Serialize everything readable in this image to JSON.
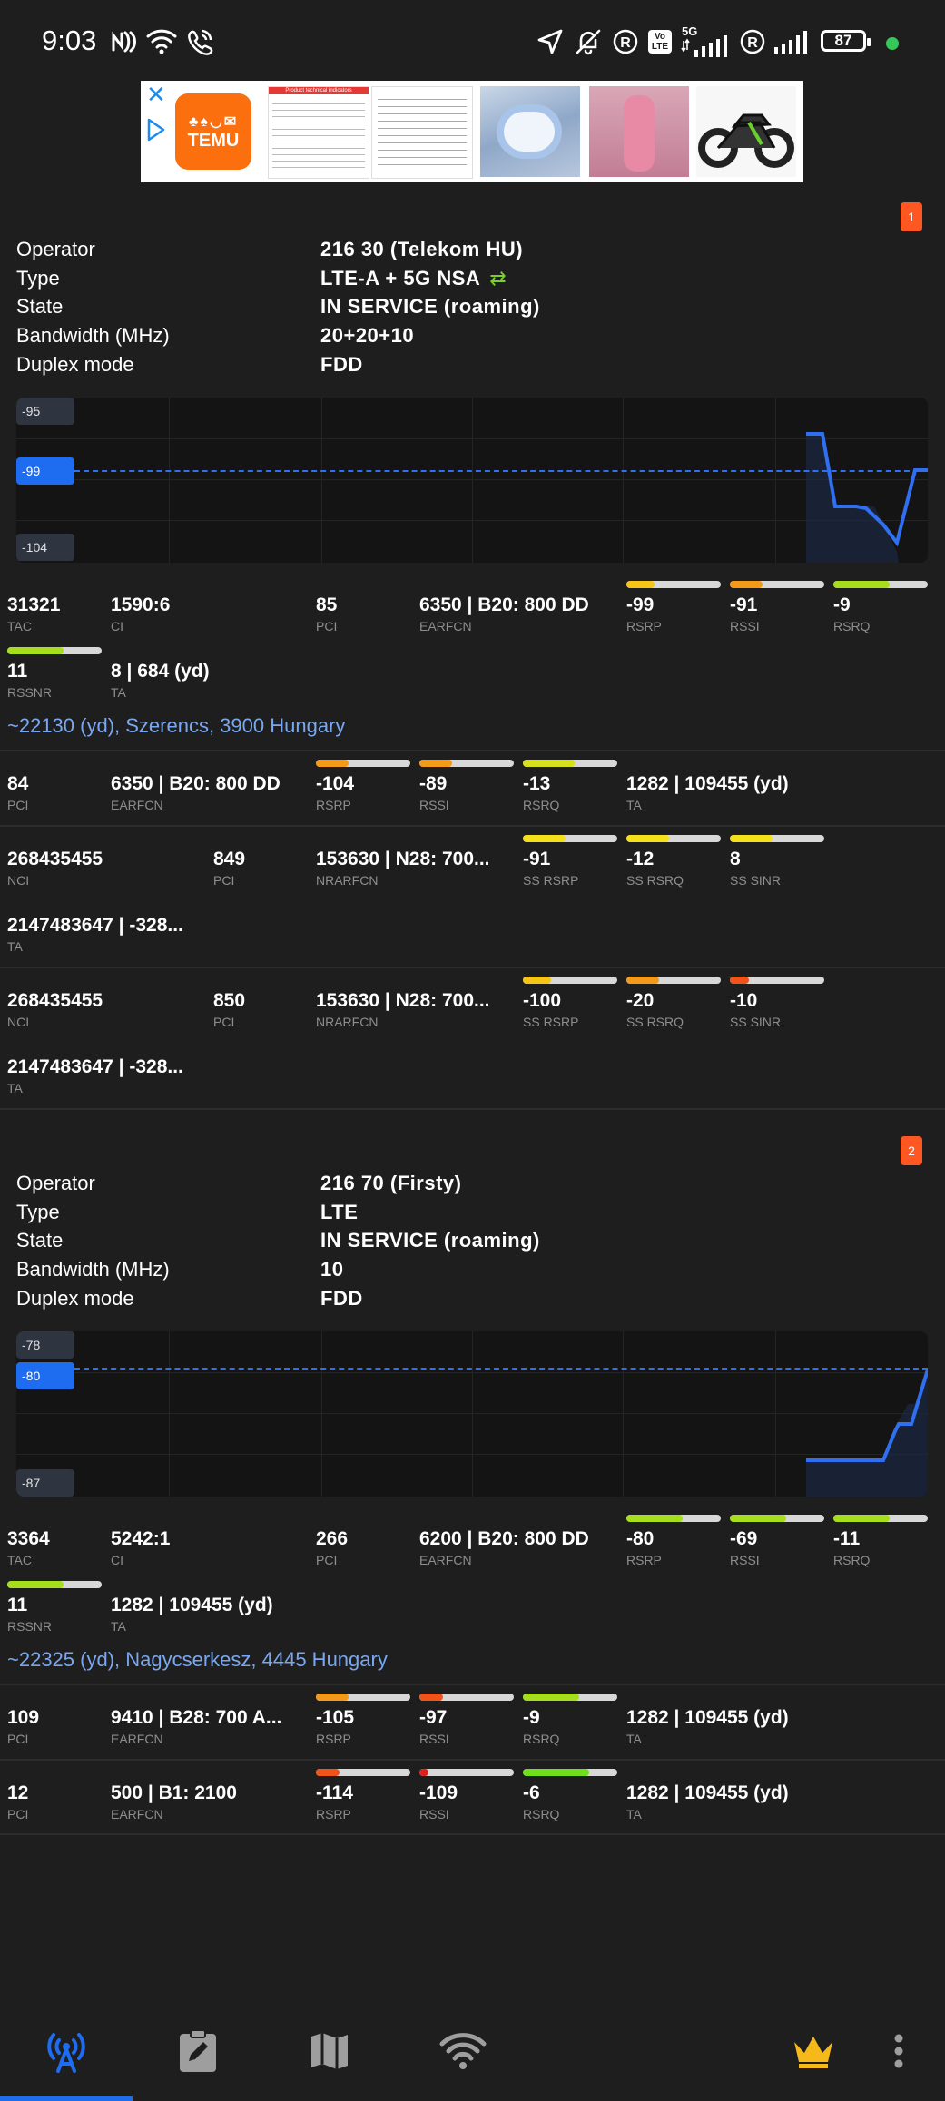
{
  "status_bar": {
    "time": "9:03",
    "battery": "87",
    "icons": [
      "nfc-icon",
      "wifi-icon",
      "wifi-calling-icon",
      "location-arrow-icon",
      "bell-off-icon",
      "roaming-icon",
      "volte-icon",
      "signal-5g-icon",
      "roaming-icon-2",
      "signal-icon"
    ],
    "network_label": "5G",
    "volte_label": "Vo LTE",
    "roaming_letter": "R"
  },
  "ad": {
    "brand": "TEMU",
    "sheet_header": "Product technical indicators"
  },
  "sims": [
    {
      "badge": "1",
      "info": [
        {
          "label": "Operator",
          "value": "216 30 (Telekom HU)"
        },
        {
          "label": "Type",
          "value": "LTE-A + 5G NSA"
        },
        {
          "label": "State",
          "value": "IN SERVICE (roaming)"
        },
        {
          "label": "Bandwidth (MHz)",
          "value": "20+20+10"
        },
        {
          "label": "Duplex mode",
          "value": "FDD"
        }
      ],
      "graph": {
        "top": "-95",
        "current": "-99",
        "bottom": "-104"
      },
      "primary": {
        "row1": [
          {
            "value": "31321",
            "label": "TAC"
          },
          {
            "value": "1590:6",
            "label": "CI"
          },
          {
            "value": "85",
            "label": "PCI"
          },
          {
            "value": "6350 | B20: 800 DD",
            "label": "EARFCN"
          },
          {
            "value": "-99",
            "label": "RSRP",
            "level": 0.3,
            "color": "#f5c518"
          },
          {
            "value": "-91",
            "label": "RSSI",
            "level": 0.35,
            "color": "#f39a1a"
          },
          {
            "value": "-9",
            "label": "RSRQ",
            "level": 0.6,
            "color": "#a6dd1c"
          }
        ],
        "row2": [
          {
            "value": "11",
            "label": "RSSNR",
            "level": 0.6,
            "color": "#a6dd1c"
          },
          {
            "value": "8 | 684 (yd)",
            "label": "TA"
          }
        ],
        "location": "~22130 (yd), Szerencs, 3900 Hungary"
      },
      "neighbors_lte": [
        {
          "cells": [
            {
              "value": "84",
              "label": "PCI"
            },
            {
              "value": "6350 | B20: 800 DD",
              "label": "EARFCN"
            },
            {
              "value": "-104",
              "label": "RSRP",
              "level": 0.35,
              "color": "#f39a1a"
            },
            {
              "value": "-89",
              "label": "RSSI",
              "level": 0.35,
              "color": "#f39a1a"
            },
            {
              "value": "-13",
              "label": "RSRQ",
              "level": 0.55,
              "color": "#d7e01c"
            },
            {
              "value": "1282 | 109455 (yd)",
              "label": "TA"
            }
          ]
        }
      ],
      "neighbors_nr": [
        {
          "cells": [
            {
              "value": "268435455",
              "label": "NCI"
            },
            {
              "value": "849",
              "label": "PCI"
            },
            {
              "value": "153630 | N28: 700...",
              "label": "NRARFCN"
            },
            {
              "value": "-91",
              "label": "SS RSRP",
              "level": 0.45,
              "color": "#f5e11a"
            },
            {
              "value": "-12",
              "label": "SS RSRQ",
              "level": 0.45,
              "color": "#f5e11a"
            },
            {
              "value": "8",
              "label": "SS SINR",
              "level": 0.45,
              "color": "#f5e11a"
            }
          ],
          "ta": {
            "value": "2147483647 | -328...",
            "label": "TA"
          }
        },
        {
          "cells": [
            {
              "value": "268435455",
              "label": "NCI"
            },
            {
              "value": "850",
              "label": "PCI"
            },
            {
              "value": "153630 | N28: 700...",
              "label": "NRARFCN"
            },
            {
              "value": "-100",
              "label": "SS RSRP",
              "level": 0.3,
              "color": "#f5c518"
            },
            {
              "value": "-20",
              "label": "SS RSRQ",
              "level": 0.35,
              "color": "#f39a1a"
            },
            {
              "value": "-10",
              "label": "SS SINR",
              "level": 0.2,
              "color": "#f0541a"
            }
          ],
          "ta": {
            "value": "2147483647 | -328...",
            "label": "TA"
          }
        }
      ]
    },
    {
      "badge": "2",
      "info": [
        {
          "label": "Operator",
          "value": "216 70 (Firsty)"
        },
        {
          "label": "Type",
          "value": "LTE"
        },
        {
          "label": "State",
          "value": "IN SERVICE (roaming)"
        },
        {
          "label": "Bandwidth (MHz)",
          "value": "10"
        },
        {
          "label": "Duplex mode",
          "value": "FDD"
        }
      ],
      "graph": {
        "top": "-78",
        "current": "-80",
        "bottom": "-87"
      },
      "primary": {
        "row1": [
          {
            "value": "3364",
            "label": "TAC"
          },
          {
            "value": "5242:1",
            "label": "CI"
          },
          {
            "value": "266",
            "label": "PCI"
          },
          {
            "value": "6200 | B20: 800 DD",
            "label": "EARFCN"
          },
          {
            "value": "-80",
            "label": "RSRP",
            "level": 0.6,
            "color": "#a6dd1c"
          },
          {
            "value": "-69",
            "label": "RSSI",
            "level": 0.6,
            "color": "#a6dd1c"
          },
          {
            "value": "-11",
            "label": "RSRQ",
            "level": 0.6,
            "color": "#a6dd1c"
          }
        ],
        "row2": [
          {
            "value": "11",
            "label": "RSSNR",
            "level": 0.6,
            "color": "#a6dd1c"
          },
          {
            "value": "1282 | 109455 (yd)",
            "label": "TA"
          }
        ],
        "location": "~22325 (yd), Nagycserkesz, 4445 Hungary"
      },
      "neighbors_lte": [
        {
          "cells": [
            {
              "value": "109",
              "label": "PCI"
            },
            {
              "value": "9410 | B28: 700 A...",
              "label": "EARFCN"
            },
            {
              "value": "-105",
              "label": "RSRP",
              "level": 0.35,
              "color": "#f39a1a"
            },
            {
              "value": "-97",
              "label": "RSSI",
              "level": 0.25,
              "color": "#f0541a"
            },
            {
              "value": "-9",
              "label": "RSRQ",
              "level": 0.6,
              "color": "#a6dd1c"
            },
            {
              "value": "1282 | 109455 (yd)",
              "label": "TA"
            }
          ]
        },
        {
          "cells": [
            {
              "value": "12",
              "label": "PCI"
            },
            {
              "value": "500 | B1: 2100",
              "label": "EARFCN"
            },
            {
              "value": "-114",
              "label": "RSRP",
              "level": 0.25,
              "color": "#f0541a"
            },
            {
              "value": "-109",
              "label": "RSSI",
              "level": 0.1,
              "color": "#e0201a"
            },
            {
              "value": "-6",
              "label": "RSRQ",
              "level": 0.7,
              "color": "#6fe01c"
            },
            {
              "value": "1282 | 109455 (yd)",
              "label": "TA"
            }
          ]
        }
      ]
    }
  ],
  "bottom_nav": [
    {
      "name": "nav-cell-towers",
      "icon": "antenna-icon",
      "active": true
    },
    {
      "name": "nav-log",
      "icon": "clipboard-edit-icon",
      "active": false
    },
    {
      "name": "nav-map",
      "icon": "map-icon",
      "active": false
    },
    {
      "name": "nav-wifi",
      "icon": "wifi-icon",
      "active": false
    },
    {
      "name": "nav-premium",
      "icon": "crown-icon",
      "active": false
    },
    {
      "name": "nav-more",
      "icon": "more-vert-icon",
      "active": false
    }
  ],
  "colors": {
    "accent": "#1e6cf0",
    "background": "#1e1e1e",
    "location": "#7aa8f0",
    "badge": "#ff5722"
  }
}
